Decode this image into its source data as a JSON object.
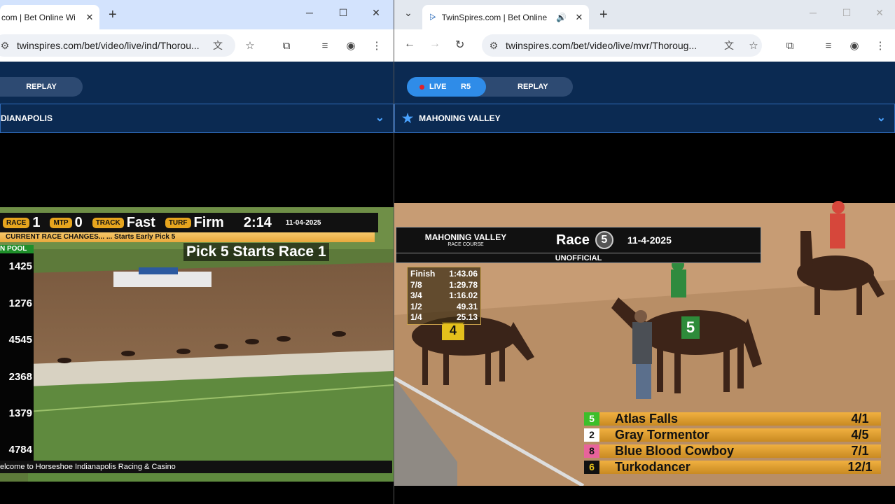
{
  "left": {
    "tab_title": "com | Bet Online Wi",
    "url": "twinspires.com/bet/video/live/ind/Thorou...",
    "replay_label": "REPLAY",
    "track_name": "DIANAPOLIS",
    "hud": {
      "race_label": "RACE",
      "race_num": "1",
      "mtp_label": "MTP",
      "mtp_val": "0",
      "track_label": "TRACK",
      "track_val": "Fast",
      "turf_label": "TURF",
      "turf_val": "Firm",
      "time": "2:14",
      "date": "11-04-2025"
    },
    "ticker": "CURRENT RACE CHANGES...   ... Starts Early Pick 5",
    "pick5": "Pick 5 Starts Race 1",
    "pool_label": "N POOL",
    "probables": [
      "1425",
      "1276",
      "4545",
      "2368",
      "1379",
      "4784"
    ],
    "welcome": "elcome to Horseshoe Indianapolis Racing & Casino"
  },
  "right": {
    "tab_title": "TwinSpires.com | Bet Online",
    "url": "twinspires.com/bet/video/live/mvr/Thoroug...",
    "live_label": "LIVE",
    "race_code": "R5",
    "replay_label": "REPLAY",
    "track_name": "MAHONING VALLEY",
    "board": {
      "track": "MAHONING VALLEY",
      "sub": "RACE COURSE",
      "race_label": "Race",
      "race_num": "5",
      "date": "11-4-2025",
      "status": "UNOFFICIAL"
    },
    "fractions": [
      {
        "label": "Finish",
        "time": "1:43.06"
      },
      {
        "label": "7/8",
        "time": "1:29.78"
      },
      {
        "label": "3/4",
        "time": "1:16.02"
      },
      {
        "label": "1/2",
        "time": "49.31"
      },
      {
        "label": "1/4",
        "time": "25.13"
      }
    ],
    "odds": [
      {
        "num": "5",
        "name": "Atlas Falls",
        "odds": "4/1",
        "color": "#3cbf2a"
      },
      {
        "num": "2",
        "name": "Gray Tormentor",
        "odds": "4/5",
        "color": "#ffffff"
      },
      {
        "num": "8",
        "name": "Blue Blood Cowboy",
        "odds": "7/1",
        "color": "#e8639b"
      },
      {
        "num": "6",
        "name": "Turkodancer",
        "odds": "12/1",
        "color": "#111111"
      }
    ]
  }
}
